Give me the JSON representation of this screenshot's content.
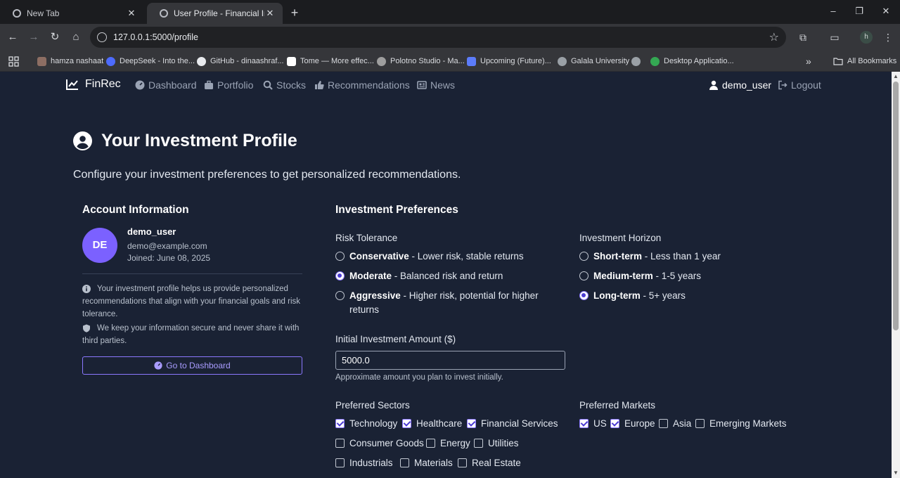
{
  "browser": {
    "tabs": [
      {
        "title": "New Tab"
      },
      {
        "title": "User Profile - Financial Investment"
      }
    ],
    "url": "127.0.0.1:5000/profile",
    "profile_initial": "h",
    "bookmarks": [
      {
        "label": "hamza nashaat",
        "color": "#8d6e63"
      },
      {
        "label": "DeepSeek - Into the...",
        "color": "#4d6bfe"
      },
      {
        "label": "GitHub - dinaashraf...",
        "color": "#e8eaed"
      },
      {
        "label": "Tome — More effec...",
        "color": "#ffffff"
      },
      {
        "label": "Polotno Studio - Ma...",
        "color": "#9e9e9e"
      },
      {
        "label": "Upcoming (Future)...",
        "color": "#5c7cfa"
      },
      {
        "label": "Galala University",
        "color": "#9aa0a6"
      },
      {
        "label": "",
        "color": "#9aa0a6"
      },
      {
        "label": "Desktop Applicatio...",
        "color": "#34a853"
      }
    ],
    "all_bookmarks": "All Bookmarks"
  },
  "nav": {
    "brand": "FinRec",
    "links": [
      "Dashboard",
      "Portfolio",
      "Stocks",
      "Recommendations",
      "News"
    ],
    "user": "demo_user",
    "logout": "Logout"
  },
  "page": {
    "title": "Your Investment Profile",
    "lead": "Configure your investment preferences to get personalized recommendations."
  },
  "account": {
    "title": "Account Information",
    "initials": "DE",
    "username": "demo_user",
    "email": "demo@example.com",
    "joined": "Joined: June 08, 2025",
    "note1": "Your investment profile helps us provide personalized recommendations that align with your financial goals and risk tolerance.",
    "note2": "We keep your information secure and never share it with third parties.",
    "dashboard_button": "Go to Dashboard"
  },
  "preferences": {
    "title": "Investment Preferences",
    "risk_label": "Risk Tolerance",
    "risk_options": [
      {
        "name": "Conservative",
        "desc": " - Lower risk, stable returns",
        "selected": false
      },
      {
        "name": "Moderate",
        "desc": " - Balanced risk and return",
        "selected": true
      },
      {
        "name": "Aggressive",
        "desc": " - Higher risk, potential for higher returns",
        "selected": false
      }
    ],
    "horizon_label": "Investment Horizon",
    "horizon_options": [
      {
        "name": "Short-term",
        "desc": " - Less than 1 year",
        "selected": false
      },
      {
        "name": "Medium-term",
        "desc": " - 1-5 years",
        "selected": false
      },
      {
        "name": "Long-term",
        "desc": " - 5+ years",
        "selected": true
      }
    ],
    "amount_label": "Initial Investment Amount ($)",
    "amount_value": "5000.0",
    "amount_help": "Approximate amount you plan to invest initially.",
    "sectors_label": "Preferred Sectors",
    "sectors": [
      {
        "name": "Technology",
        "checked": true
      },
      {
        "name": "Healthcare",
        "checked": true
      },
      {
        "name": "Financial Services",
        "checked": true
      },
      {
        "name": "Consumer Goods",
        "checked": false
      },
      {
        "name": "Energy",
        "checked": false
      },
      {
        "name": "Utilities",
        "checked": false
      },
      {
        "name": "Industrials",
        "checked": false
      },
      {
        "name": "Materials",
        "checked": false
      },
      {
        "name": "Real Estate",
        "checked": false
      }
    ],
    "markets_label": "Preferred Markets",
    "markets": [
      {
        "name": "US",
        "checked": true
      },
      {
        "name": "Europe",
        "checked": true
      },
      {
        "name": "Asia",
        "checked": false
      },
      {
        "name": "Emerging Markets",
        "checked": false
      }
    ]
  },
  "colors": {
    "accent": "#7b61ff",
    "page_bg": "#1a2234"
  }
}
